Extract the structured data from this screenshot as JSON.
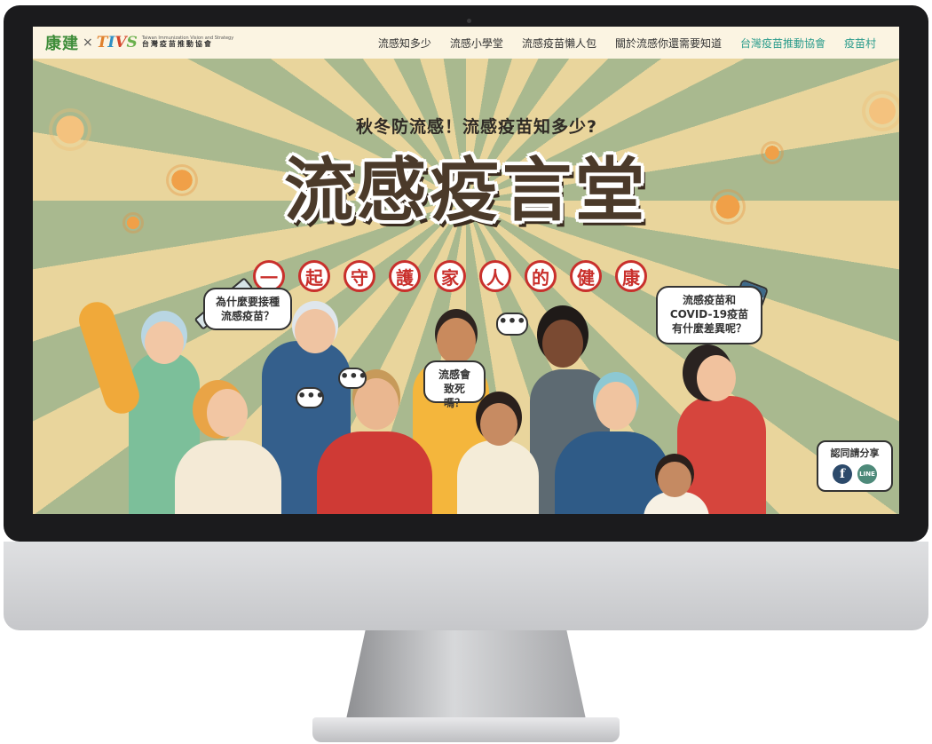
{
  "header": {
    "logo_primary": "康建",
    "logo_separator": "×",
    "logo_secondary": "TIVS",
    "logo_en": "Taiwan Immunization Vision and Strategy",
    "logo_zh": "台灣疫苗推動協會",
    "nav": [
      {
        "label": "流感知多少"
      },
      {
        "label": "流感小學堂"
      },
      {
        "label": "流感疫苗懶人包"
      },
      {
        "label": "關於流感你還需要知道"
      },
      {
        "label": "台灣疫苗推動協會"
      },
      {
        "label": "疫苗村"
      }
    ]
  },
  "hero": {
    "subtitle": "秋冬防流感！流感疫苗知多少?",
    "title": "流感疫言堂",
    "slogan": [
      "一",
      "起",
      "守",
      "護",
      "家",
      "人",
      "的",
      "健",
      "康"
    ]
  },
  "bubbles": {
    "why_vaccinate": "為什麼要接種\n流感疫苗？",
    "flu_death": "流感會\n致死嗎？",
    "flu_vs_covid": "流感疫苗和\nCOVID-19疫苗\n有什麼差異呢？",
    "dots": "•••"
  },
  "share": {
    "label": "認同請分享",
    "facebook_icon": "f",
    "line_icon": "LINE"
  },
  "colors": {
    "ray_light": "#e9d59c",
    "ray_green": "#a9b98f",
    "title_brown": "#4b3a2a",
    "slogan_red": "#c9302c",
    "nav_accent": "#2b9c8c"
  }
}
